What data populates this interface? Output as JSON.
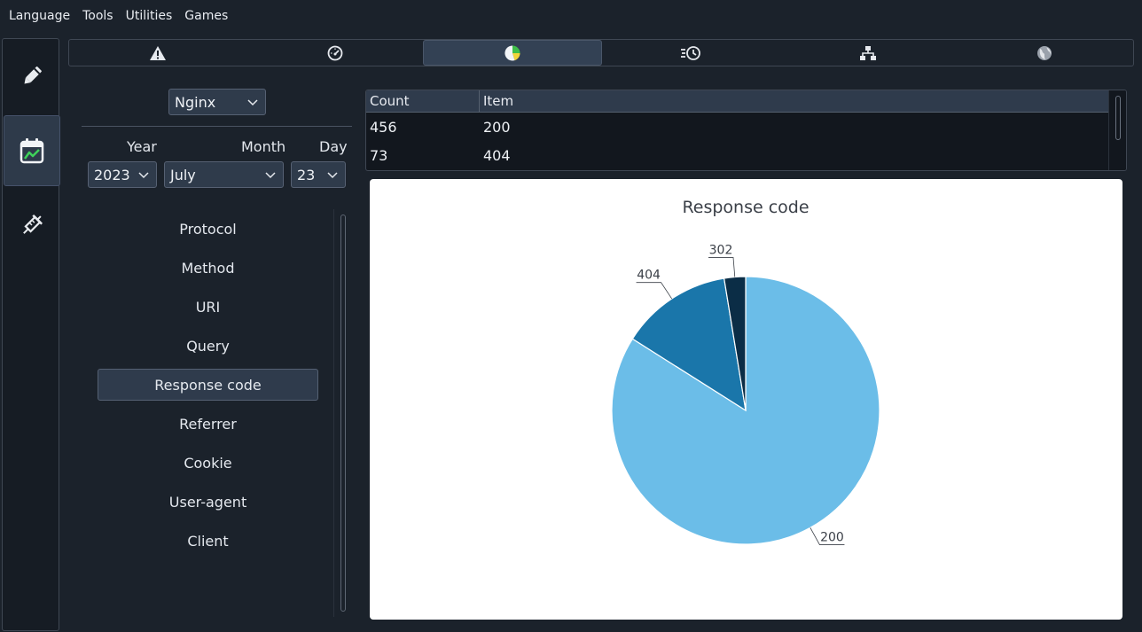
{
  "menu": {
    "items": [
      "Language",
      "Tools",
      "Utilities",
      "Games"
    ]
  },
  "sidenav": {
    "items": [
      {
        "icon": "pencil-icon"
      },
      {
        "icon": "calendar-chart-icon",
        "active": true
      },
      {
        "icon": "syringe-icon"
      }
    ]
  },
  "tabs": [
    {
      "icon": "warning-icon"
    },
    {
      "icon": "gauge-icon"
    },
    {
      "icon": "pie-chart-icon",
      "active": true
    },
    {
      "icon": "history-icon"
    },
    {
      "icon": "network-icon"
    },
    {
      "icon": "globe-icon"
    }
  ],
  "source_select": {
    "value": "Nginx"
  },
  "date": {
    "year_label": "Year",
    "month_label": "Month",
    "day_label": "Day",
    "year": "2023",
    "month": "July",
    "day": "23"
  },
  "fields": {
    "items": [
      "Protocol",
      "Method",
      "URI",
      "Query",
      "Response code",
      "Referrer",
      "Cookie",
      "User-agent",
      "Client"
    ],
    "selected": "Response code"
  },
  "table": {
    "headers": [
      "Count",
      "Item"
    ],
    "rows": [
      [
        "456",
        "200"
      ],
      [
        "73",
        "404"
      ]
    ]
  },
  "chart_data": {
    "type": "pie",
    "title": "Response code",
    "categories": [
      "200",
      "404",
      "302"
    ],
    "values": [
      456,
      73,
      14
    ],
    "colors": [
      "#6bbde8",
      "#1a76aa",
      "#0b2d46"
    ]
  }
}
